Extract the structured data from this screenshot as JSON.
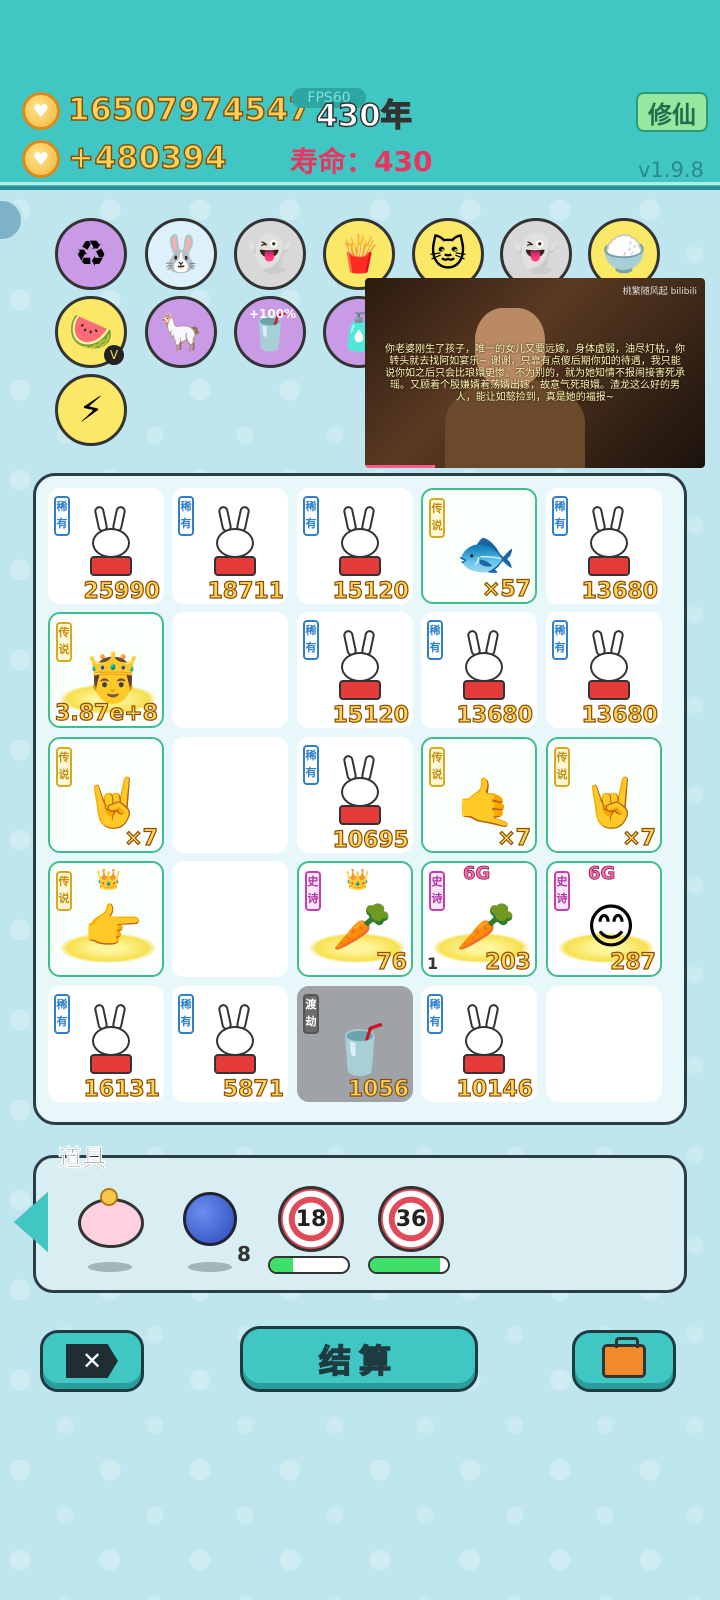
{
  "header": {
    "coins": "16507974547",
    "income": "+480394",
    "year": "430年",
    "fps": "FPS60",
    "life_label": "寿命：",
    "life_value": "430",
    "cultivate_label": "修仙",
    "version": "v1.9.8"
  },
  "buffs": [
    {
      "name": "recycle-icon",
      "color": "#c99be6",
      "glyph": "♻"
    },
    {
      "name": "bunny-icon",
      "color": "#ddf1fb",
      "glyph": "🐰"
    },
    {
      "name": "ghost-icon",
      "color": "#d8d8d8",
      "glyph": "👻"
    },
    {
      "name": "fries-icon",
      "color": "#fbe866",
      "glyph": "🍟"
    },
    {
      "name": "cat-icon",
      "color": "#fbe866",
      "glyph": "🐱"
    },
    {
      "name": "ghost-icon",
      "color": "#d8d8d8",
      "glyph": "👻"
    },
    {
      "name": "rice-icon",
      "color": "#fbe866",
      "glyph": "🍚"
    },
    {
      "name": "fruit-basket-icon",
      "color": "#fbe866",
      "glyph": "🍉",
      "badge": "V"
    },
    {
      "name": "alpaca-icon",
      "color": "#c99be6",
      "glyph": "🦙"
    },
    {
      "name": "drink-icon",
      "color": "#c99be6",
      "glyph": "🥤",
      "label": "+100%"
    },
    {
      "name": "bottle-icon",
      "color": "#c99be6",
      "glyph": "🧴"
    },
    {
      "name": "lightning-icon",
      "color": "#fbe866",
      "glyph": "⚡"
    }
  ],
  "video": {
    "logo": "桃繁随风起 bilibili",
    "subtitle": "你老婆刚生了孩子，唯一的女儿又要远嫁，身体虚弱，油尽灯枯，你转头就去找阿如宴乐~ 谢谢，只靠有点傻后期你如的待遇，我只能说你如之后只会比琅嬛更惨。不为别的，就为她知情不报闹接害死承瑶。又顾着个殷嫌婿着荡婿出嫁，故意气死琅嬛。渣龙这么好的男人，能让如懿捡到，真是她的福报~"
  },
  "grid": [
    {
      "rarity": "稀有",
      "tier": "rare",
      "icon": "bunny",
      "count": "25990"
    },
    {
      "rarity": "稀有",
      "tier": "rare",
      "icon": "bunny",
      "count": "18711"
    },
    {
      "rarity": "稀有",
      "tier": "rare",
      "icon": "bunny",
      "count": "15120"
    },
    {
      "rarity": "传说",
      "tier": "legend",
      "icon": "🐟",
      "count": "×57"
    },
    {
      "rarity": "稀有",
      "tier": "rare",
      "icon": "bunny",
      "count": "13680"
    },
    {
      "rarity": "传说",
      "tier": "legend",
      "icon": "🤴",
      "count": "3.87e+8",
      "halo": true
    },
    {
      "empty": true
    },
    {
      "rarity": "稀有",
      "tier": "rare",
      "icon": "bunny",
      "count": "15120"
    },
    {
      "rarity": "稀有",
      "tier": "rare",
      "icon": "bunny",
      "count": "13680"
    },
    {
      "rarity": "稀有",
      "tier": "rare",
      "icon": "bunny",
      "count": "13680"
    },
    {
      "rarity": "传说",
      "tier": "legend",
      "icon": "🤘",
      "count": "×7"
    },
    {
      "empty": true
    },
    {
      "rarity": "稀有",
      "tier": "rare",
      "icon": "bunny",
      "count": "10695"
    },
    {
      "rarity": "传说",
      "tier": "legend",
      "icon": "🤙",
      "count": "×7"
    },
    {
      "rarity": "传说",
      "tier": "legend",
      "icon": "🤘",
      "count": "×7"
    },
    {
      "rarity": "传说",
      "tier": "legend",
      "icon": "👉",
      "count": "",
      "halo": true,
      "crown": true
    },
    {
      "empty": true
    },
    {
      "rarity": "史诗",
      "tier": "epic",
      "icon": "🥕",
      "count": "76",
      "halo": true,
      "crown": true
    },
    {
      "rarity": "史诗",
      "tier": "epic",
      "icon": "🥕",
      "count": "203",
      "small": "1",
      "tag": "6G",
      "halo": true
    },
    {
      "rarity": "史诗",
      "tier": "epic",
      "icon": "😊",
      "count": "287",
      "tag": "6G",
      "halo": true
    },
    {
      "rarity": "稀有",
      "tier": "rare",
      "icon": "bunny",
      "count": "16131"
    },
    {
      "rarity": "稀有",
      "tier": "rare",
      "icon": "bunny",
      "count": "5871"
    },
    {
      "rarity": "渡劫",
      "tier": "gray",
      "icon": "🥤",
      "count": "1056"
    },
    {
      "rarity": "稀有",
      "tier": "rare",
      "icon": "bunny",
      "count": "10146"
    },
    {
      "empty": true
    }
  ],
  "props": {
    "title": "道具",
    "berry_count": "8",
    "target1": "18",
    "target1_progress": 0.3,
    "target2": "36",
    "target2_progress": 0.9
  },
  "buttons": {
    "settle": "结算"
  }
}
